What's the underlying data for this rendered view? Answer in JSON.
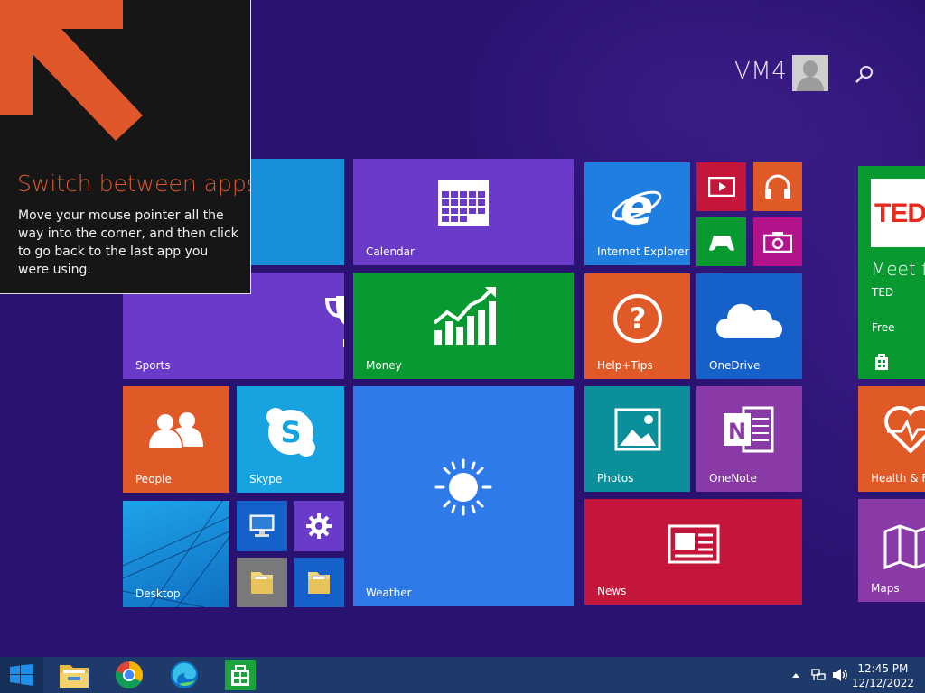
{
  "user": {
    "name": "VM4",
    "avatar_icon": "user-avatar-icon",
    "search_icon": "search-icon"
  },
  "tip": {
    "title": "Switch between apps",
    "body": "Move your mouse pointer all the way into the corner, and then click to go back to the last app you were using.",
    "accent": "#e0572b"
  },
  "tiles": {
    "sports": {
      "label": "Sports",
      "color": "#6a3bc9",
      "icon": "trophy-icon"
    },
    "calendar": {
      "label": "Calendar",
      "color": "#6a3bc9",
      "icon": "calendar-icon"
    },
    "money": {
      "label": "Money",
      "color": "#089a30",
      "icon": "chart-icon"
    },
    "people": {
      "label": "People",
      "color": "#e05a28",
      "icon": "people-icon"
    },
    "skype": {
      "label": "Skype",
      "color": "#16a3e0",
      "icon": "skype-icon"
    },
    "weather": {
      "label": "Weather",
      "color": "#2d7ae8",
      "icon": "sun-icon"
    },
    "desktop": {
      "label": "Desktop",
      "color": "#1a8fd9",
      "icon": "desktop-wallpaper"
    },
    "internet_explorer": {
      "label": "Internet Explorer",
      "color": "#1e7fe0",
      "icon": "ie-icon"
    },
    "help_tips": {
      "label": "Help+Tips",
      "color": "#e05a28",
      "icon": "question-icon"
    },
    "onedrive": {
      "label": "OneDrive",
      "color": "#1560c9",
      "icon": "cloud-icon"
    },
    "photos": {
      "label": "Photos",
      "color": "#0b8f9b",
      "icon": "photo-icon"
    },
    "onenote": {
      "label": "OneNote",
      "color": "#8a3aa7",
      "icon": "onenote-icon"
    },
    "news": {
      "label": "News",
      "color": "#c4153a",
      "icon": "news-icon"
    },
    "video": {
      "color": "#c4153a",
      "icon": "video-icon"
    },
    "music": {
      "color": "#e05a28",
      "icon": "headphones-icon"
    },
    "games": {
      "color": "#089a30",
      "icon": "gamepad-icon"
    },
    "camera": {
      "color": "#b3128a",
      "icon": "camera-icon"
    },
    "ted": {
      "title": "Meet fa",
      "sub": "TED",
      "price": "Free",
      "logo_text": "TED",
      "color": "#089a30",
      "icon": "store-icon"
    },
    "health": {
      "label": "Health & Fit",
      "color": "#e05a28",
      "icon": "heart-icon"
    },
    "maps": {
      "label": "Maps",
      "color": "#8a3aa7",
      "icon": "map-icon"
    },
    "small": {
      "computer": {
        "color": "#1560c9",
        "icon": "computer-icon"
      },
      "settings": {
        "color": "#6a3bc9",
        "icon": "gear-icon"
      },
      "documents": {
        "color": "#7a7a7a",
        "icon": "folder-docs-icon"
      },
      "explorer": {
        "color": "#1560c9",
        "icon": "folder-icon"
      }
    }
  },
  "taskbar": {
    "start_icon": "windows-start-icon",
    "apps": [
      {
        "name": "file-explorer",
        "icon": "folder-icon"
      },
      {
        "name": "chrome",
        "icon": "chrome-icon"
      },
      {
        "name": "edge",
        "icon": "edge-icon"
      },
      {
        "name": "store",
        "icon": "store-icon"
      }
    ],
    "time": "12:45 PM",
    "date": "12/12/2022"
  }
}
